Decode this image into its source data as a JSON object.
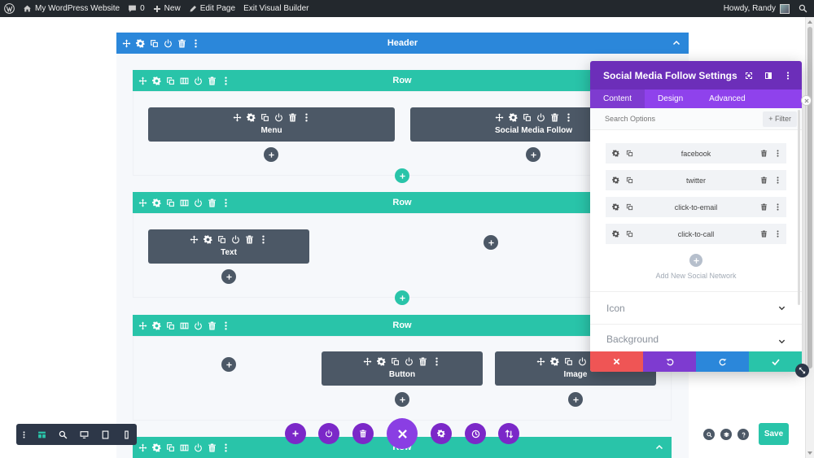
{
  "admin_bar": {
    "site_name": "My WordPress Website",
    "comments_count": "0",
    "new_label": "New",
    "edit_page_label": "Edit Page",
    "exit_builder_label": "Exit Visual Builder",
    "greeting": "Howdy, Randy"
  },
  "sections": [
    {
      "label": "Header"
    }
  ],
  "rows": [
    {
      "label": "Row",
      "modules": [
        "Menu",
        "Social Media Follow"
      ]
    },
    {
      "label": "Row",
      "modules": [
        "Text"
      ]
    },
    {
      "label": "Row",
      "modules": [
        "Button",
        "Image"
      ]
    },
    {
      "label": "Row"
    }
  ],
  "settings_panel": {
    "title": "Social Media Follow Settings",
    "tabs": [
      "Content",
      "Design",
      "Advanced"
    ],
    "active_tab": "Content",
    "search_placeholder": "Search Options",
    "filter_label": "+ Filter",
    "networks": [
      "facebook",
      "twitter",
      "click-to-email",
      "click-to-call"
    ],
    "add_network_label": "Add New Social Network",
    "toggles": [
      "Icon",
      "Background"
    ],
    "footer_colors": {
      "discard": "#ef5555",
      "undo": "#7e3bd0",
      "redo": "#2b87da",
      "save": "#29c4a9"
    }
  },
  "bottom_bar": {
    "save_label": "Save"
  },
  "colors": {
    "section": "#2b87da",
    "row": "#29c4a9",
    "module": "#4c5866",
    "panel_header": "#6c2eb9",
    "panel_tabs": "#8f42ec"
  }
}
